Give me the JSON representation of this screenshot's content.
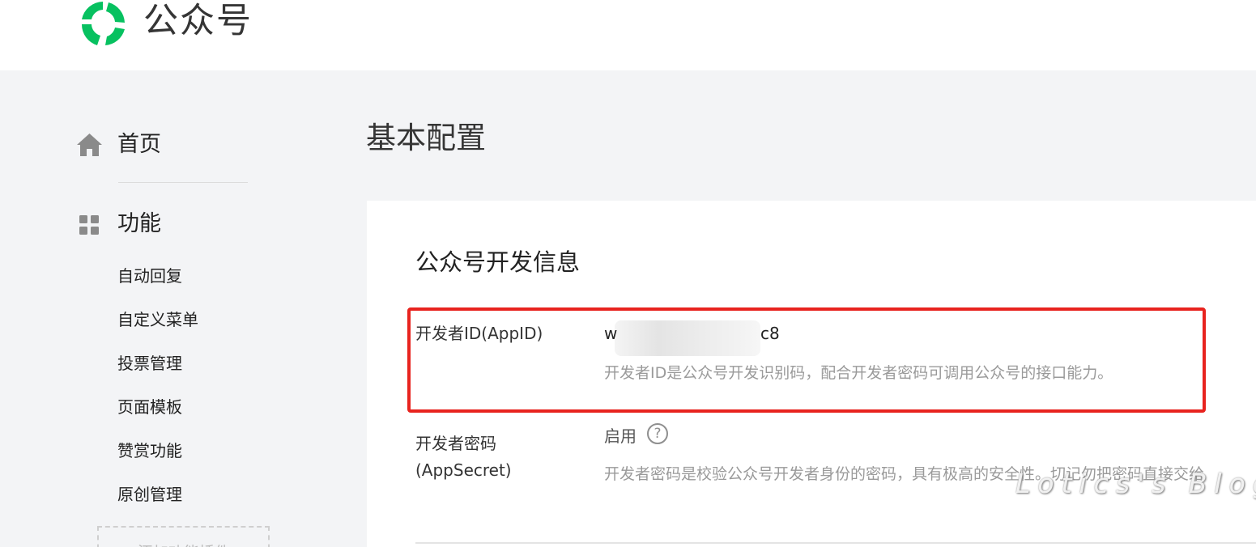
{
  "header": {
    "brand": "公众号"
  },
  "sidebar": {
    "home_label": "首页",
    "func_label": "功能",
    "items": [
      {
        "label": "自动回复"
      },
      {
        "label": "自定义菜单"
      },
      {
        "label": "投票管理"
      },
      {
        "label": "页面模板"
      },
      {
        "label": "赞赏功能"
      },
      {
        "label": "原创管理"
      }
    ],
    "add_plugin_label": "+ 添加功能插件"
  },
  "main": {
    "page_title": "基本配置",
    "section_title": "公众号开发信息",
    "appid": {
      "label": "开发者ID(AppID)",
      "value_prefix": "w",
      "value_suffix": "c8",
      "description": "开发者ID是公众号开发识别码，配合开发者密码可调用公众号的接口能力。"
    },
    "appsecret": {
      "label_line1": "开发者密码",
      "label_line2": "(AppSecret)",
      "status": "启用",
      "help_glyph": "?",
      "description": "开发者密码是校验公众号开发者身份的密码，具有极高的安全性。切记勿把密码直接交给"
    }
  },
  "watermark": "Lotics's Blog",
  "colors": {
    "brand_green": "#1aad19",
    "highlight_red": "#e8231e"
  }
}
